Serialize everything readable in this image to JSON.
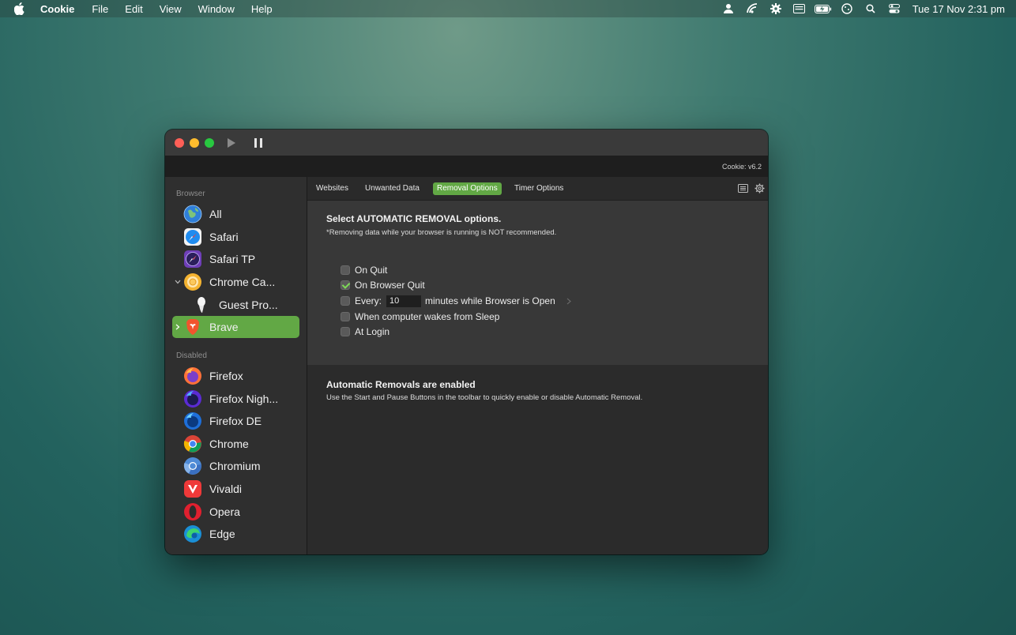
{
  "menubar": {
    "app_name": "Cookie",
    "menus": [
      "File",
      "Edit",
      "View",
      "Window",
      "Help"
    ],
    "clock": "Tue 17 Nov  2:31 pm"
  },
  "window": {
    "version": "Cookie: v6.2"
  },
  "sidebar": {
    "browser_section": "Browser",
    "disabled_section": "Disabled",
    "browsers": [
      {
        "label": "All",
        "icon": "globe-icon"
      },
      {
        "label": "Safari",
        "icon": "safari-icon"
      },
      {
        "label": "Safari TP",
        "icon": "safari-tp-icon"
      },
      {
        "label": "Chrome Ca...",
        "icon": "chrome-canary-icon"
      },
      {
        "label": "Guest Pro...",
        "icon": "guest-profile-icon"
      },
      {
        "label": "Brave",
        "icon": "brave-icon",
        "selected": true
      }
    ],
    "disabled": [
      {
        "label": "Firefox",
        "icon": "firefox-icon"
      },
      {
        "label": "Firefox Nigh...",
        "icon": "firefox-nightly-icon"
      },
      {
        "label": "Firefox DE",
        "icon": "firefox-de-icon"
      },
      {
        "label": "Chrome",
        "icon": "chrome-icon"
      },
      {
        "label": "Chromium",
        "icon": "chromium-icon"
      },
      {
        "label": "Vivaldi",
        "icon": "vivaldi-icon"
      },
      {
        "label": "Opera",
        "icon": "opera-icon"
      },
      {
        "label": "Edge",
        "icon": "edge-icon"
      }
    ]
  },
  "tabs": [
    "Websites",
    "Unwanted Data",
    "Removal Options",
    "Timer Options"
  ],
  "active_tab": "Removal Options",
  "removal": {
    "heading": "Select AUTOMATIC REMOVAL options.",
    "warning": "*Removing data while your browser is running is NOT recommended.",
    "options": {
      "on_quit": {
        "label": "On Quit",
        "checked": false
      },
      "on_browser_quit": {
        "label": "On Browser Quit",
        "checked": true
      },
      "every": {
        "label": "Every:",
        "value": "10",
        "suffix": "minutes while Browser is Open",
        "checked": false
      },
      "wake": {
        "label": "When computer wakes from Sleep",
        "checked": false
      },
      "login": {
        "label": "At Login",
        "checked": false
      }
    },
    "status_heading": "Automatic Removals are enabled",
    "status_text": "Use the Start and Pause Buttons in the toolbar to quickly enable or disable Automatic Removal."
  },
  "colors": {
    "accent": "#62a845",
    "window_bg": "#2c2c2c"
  }
}
